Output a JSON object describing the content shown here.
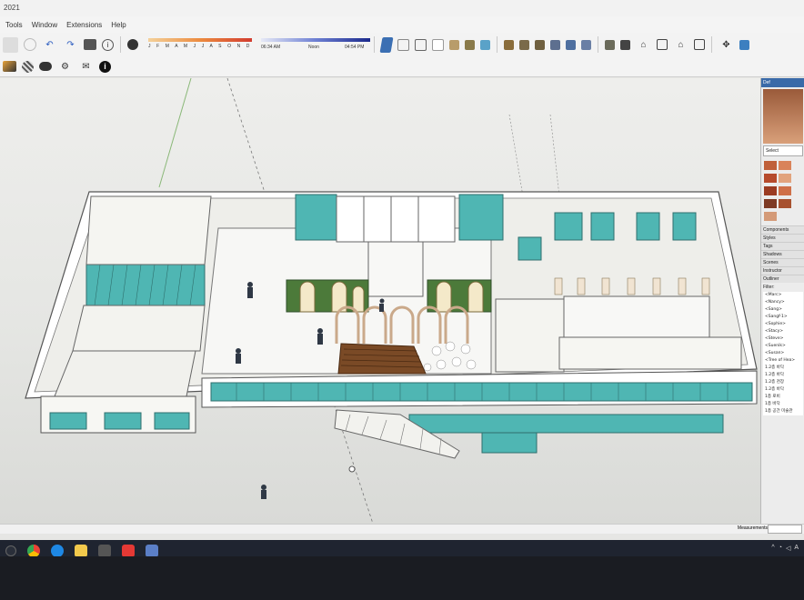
{
  "window": {
    "title_fragment": "2021"
  },
  "menu": {
    "tools": "Tools",
    "window": "Window",
    "extensions": "Extensions",
    "help": "Help"
  },
  "shadow": {
    "months": "J F M A M J J A S O N D",
    "time_start": "06:34 AM",
    "time_noon": "Noon",
    "time_end": "04:54 PM"
  },
  "right_panel": {
    "tray_title": "Def",
    "select_label": "Select",
    "sections": [
      "Components",
      "Styles",
      "Tags",
      "Shadows",
      "Scenes",
      "Instructor",
      "Outliner"
    ],
    "filter_label": "Filter:",
    "outliner_items": [
      "<Marc>",
      "<Nancy>",
      "<Sang>",
      "<Sangf-1>",
      "<Sophie>",
      "<Stacy>",
      "<Steve>",
      "<Suenik>",
      "<Susan>",
      "<Tree of Hea>",
      "1.2층 바닥",
      "1.2층 바닥",
      "1.2층 천장",
      "1.2층 바닥",
      "1층 로비",
      "1층 바닥",
      "1층 공간 미술관"
    ],
    "swatches": [
      "#c0603a",
      "#d9835a",
      "#b64a2c",
      "#e2a37d",
      "#9b3b22",
      "#cf7048",
      "#7e3a24",
      "#a7512f",
      "#d49a78"
    ]
  },
  "status": {
    "measurements": "Measurements"
  },
  "colors": {
    "teal_glass": "#4fb6b3",
    "wall": "#f4f3ef",
    "stair_wood": "#7a4a26"
  }
}
